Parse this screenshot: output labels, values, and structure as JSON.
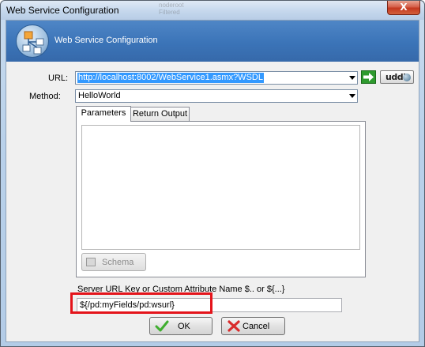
{
  "window": {
    "title": "Web Service Configuration",
    "close_symbol": "X",
    "background_ghost_lines": [
      "noderoot",
      "Filtered"
    ]
  },
  "banner": {
    "title": "Web Service Configuration",
    "icon": "web-service-icon",
    "color": "#3b74b8"
  },
  "url": {
    "label": "URL:",
    "value": "http://localhost:8002/WebService1.asmx?WSDL",
    "go_icon": "green-arrow-icon",
    "uddi_label": "uddi"
  },
  "method": {
    "label": "Method:",
    "value": "HelloWorld"
  },
  "tabs": [
    {
      "label": "Parameters",
      "active": true
    },
    {
      "label": "Return Output",
      "active": false
    }
  ],
  "parameters_panel": {
    "schema_button": "Schema",
    "schema_enabled": false
  },
  "server": {
    "label": "Server URL Key or Custom Attribute Name $.. or ${...}",
    "value": "${/pd:myFields/pd:wsurl}",
    "highlight_color": "#e4141b"
  },
  "buttons": {
    "ok": "OK",
    "cancel": "Cancel"
  }
}
